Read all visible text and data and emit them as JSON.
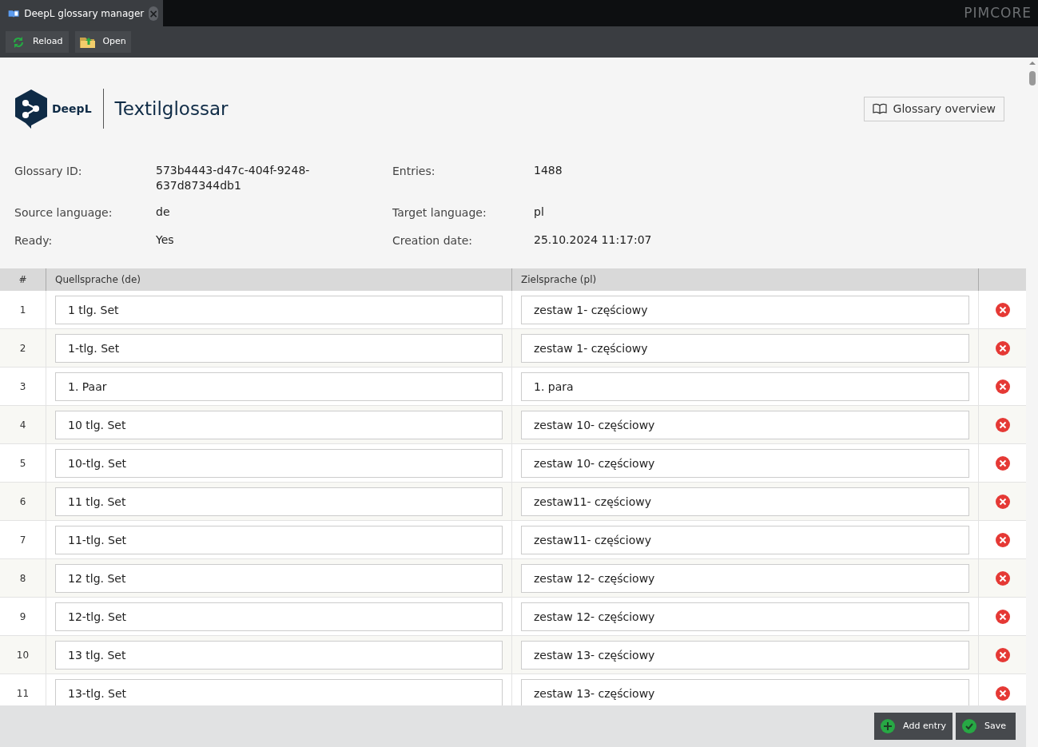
{
  "tab": {
    "title": "DeepL glossary manager",
    "close": "×"
  },
  "brand": "PIMCORE",
  "toolbar": [
    "Reload",
    "Open"
  ],
  "header": {
    "logo_text": "DeepL",
    "title": "Textilglossar",
    "overview_button": "Glossary overview"
  },
  "info": [
    {
      "label": "Glossary ID:",
      "value": "573b4443-d47c-404f-9248-637d87344db1"
    },
    {
      "label": "Entries:",
      "value": "1488"
    },
    {
      "label": "Source language:",
      "value": "de"
    },
    {
      "label": "Target language:",
      "value": "pl"
    },
    {
      "label": "Ready:",
      "value": "Yes"
    },
    {
      "label": "Creation date:",
      "value": "25.10.2024 11:17:07"
    }
  ],
  "table": {
    "columns": [
      "#",
      "Quellsprache (de)",
      "Zielsprache (pl)"
    ],
    "rows": [
      {
        "n": "1",
        "source": "1 tlg. Set",
        "target": "zestaw 1- częściowy"
      },
      {
        "n": "2",
        "source": "1-tlg. Set",
        "target": "zestaw 1- częściowy"
      },
      {
        "n": "3",
        "source": "1. Paar",
        "target": "1. para"
      },
      {
        "n": "4",
        "source": "10 tlg. Set",
        "target": "zestaw 10- częściowy"
      },
      {
        "n": "5",
        "source": "10-tlg. Set",
        "target": "zestaw 10- częściowy"
      },
      {
        "n": "6",
        "source": "11 tlg. Set",
        "target": "zestaw11- częściowy"
      },
      {
        "n": "7",
        "source": "11-tlg. Set",
        "target": "zestaw11- częściowy"
      },
      {
        "n": "8",
        "source": "12 tlg. Set",
        "target": "zestaw 12- częściowy"
      },
      {
        "n": "9",
        "source": "12-tlg. Set",
        "target": "zestaw 12- częściowy"
      },
      {
        "n": "10",
        "source": "13 tlg. Set",
        "target": "zestaw 13- częściowy"
      },
      {
        "n": "11",
        "source": "13-tlg. Set",
        "target": "zestaw 13- częściowy"
      }
    ]
  },
  "footer": [
    "Add entry",
    "Save"
  ]
}
